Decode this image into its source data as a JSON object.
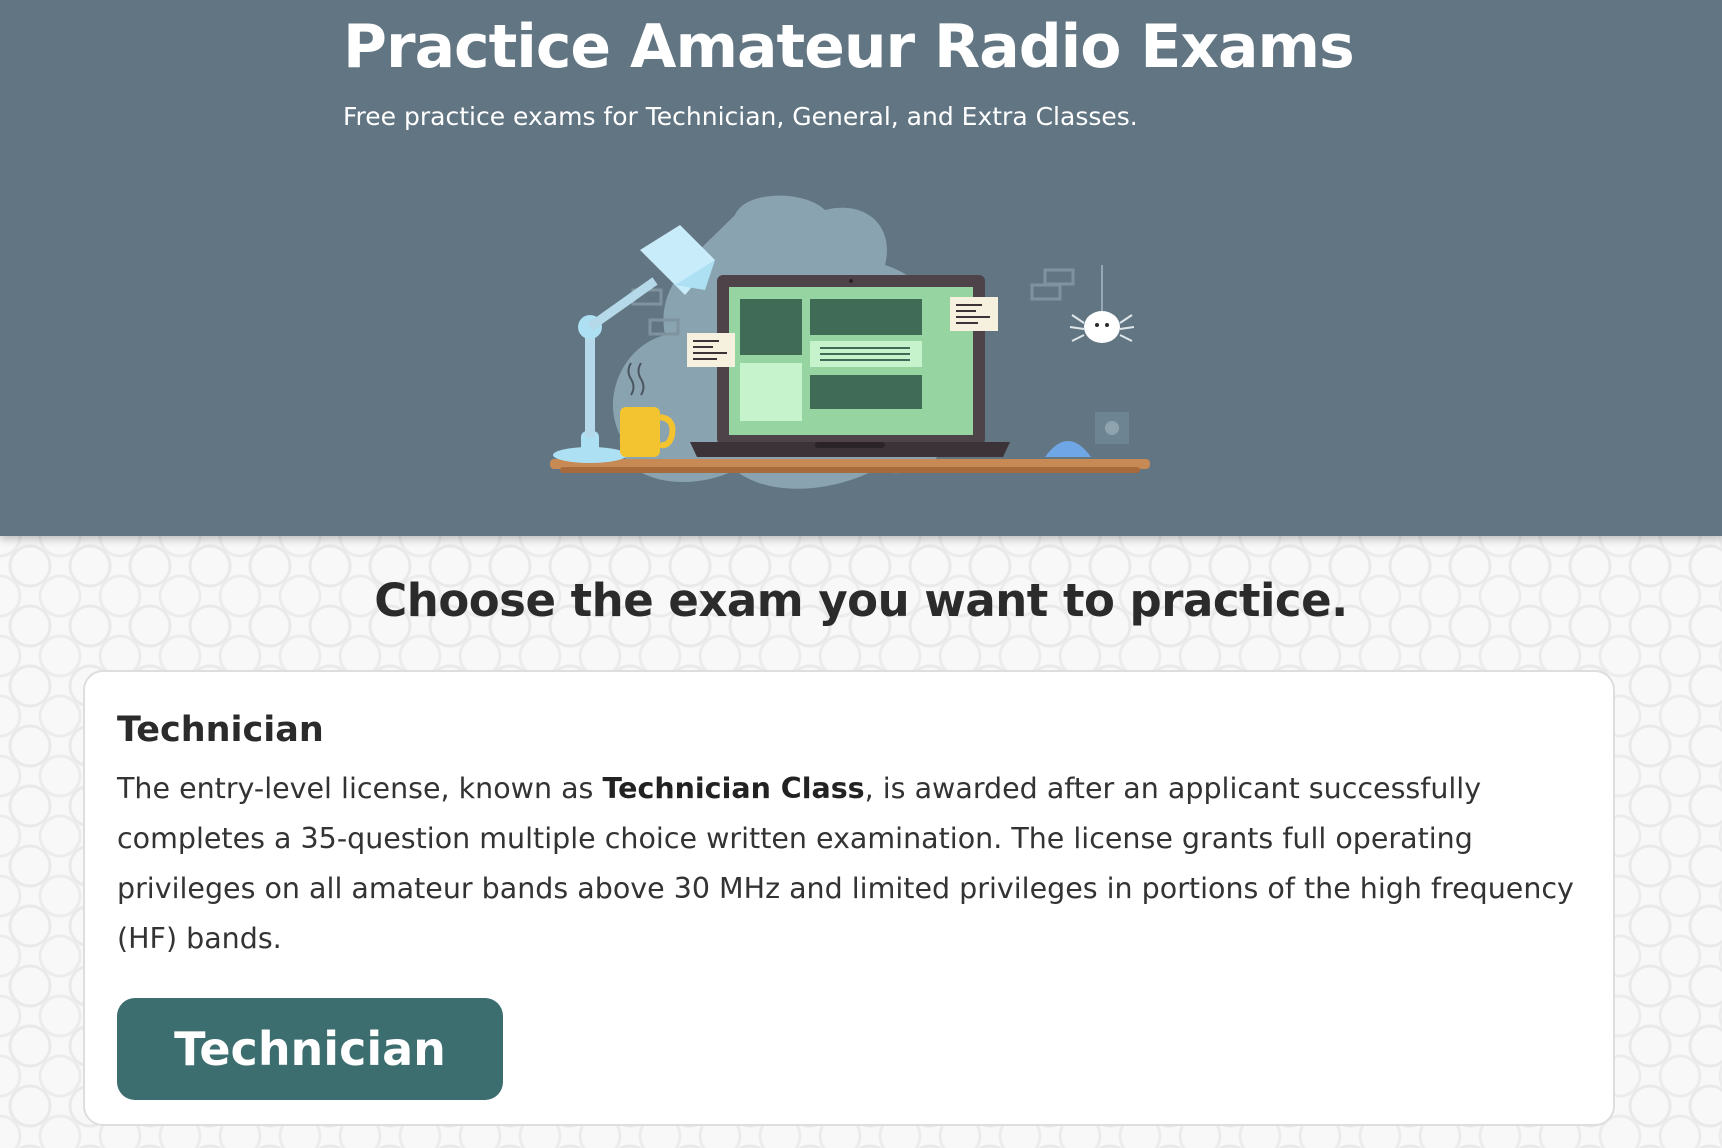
{
  "hero": {
    "title": "Practice Amateur Radio Exams",
    "subtitle": "Free practice exams for Technician, General, and Extra Classes.",
    "illustration_icon": "desk-laptop-illustration"
  },
  "main": {
    "heading": "Choose the exam you want to practice.",
    "cards": [
      {
        "title": "Technician",
        "description_prefix": "The entry-level license, known as ",
        "description_bold": "Technician Class",
        "description_suffix": ", is awarded after an applicant successfully completes a 35-question multiple choice written examination. The license grants full operating privileges on all amateur bands above 30 MHz and limited privileges in portions of the high frequency (HF) bands.",
        "button_label": "Technician"
      }
    ]
  },
  "colors": {
    "hero_background": "#627583",
    "button_background": "#3c6d6f",
    "heading_text": "#2b2b2b"
  }
}
